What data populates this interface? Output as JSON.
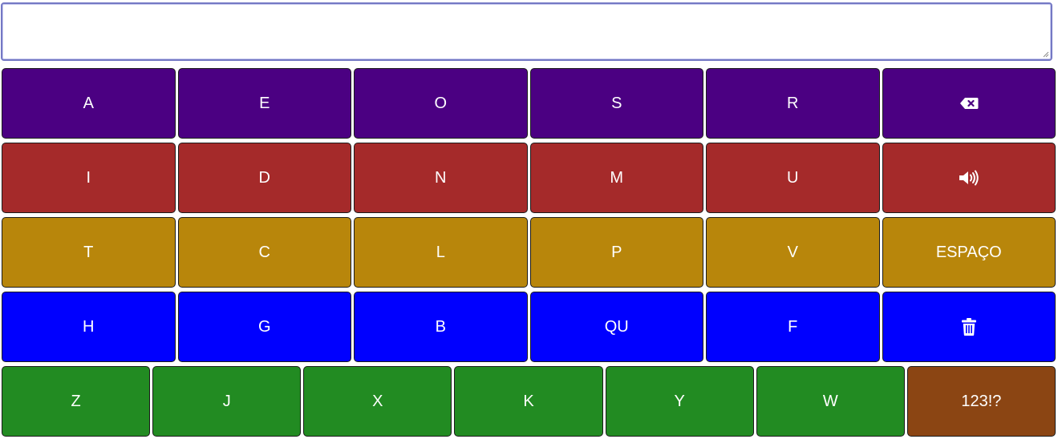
{
  "input": {
    "value": "",
    "placeholder": ""
  },
  "colors": {
    "row1": "#4b0082",
    "row2": "#a52a2a",
    "row3": "#b8860b",
    "row4": "#0000ff",
    "row5": "#228b22",
    "numbers_key": "#8b4513"
  },
  "rows": [
    {
      "keys": [
        {
          "label": "A"
        },
        {
          "label": "E"
        },
        {
          "label": "O"
        },
        {
          "label": "S"
        },
        {
          "label": "R"
        },
        {
          "label": "",
          "icon": "backspace-icon"
        }
      ]
    },
    {
      "keys": [
        {
          "label": "I"
        },
        {
          "label": "D"
        },
        {
          "label": "N"
        },
        {
          "label": "M"
        },
        {
          "label": "U"
        },
        {
          "label": "",
          "icon": "speaker-icon"
        }
      ]
    },
    {
      "keys": [
        {
          "label": "T"
        },
        {
          "label": "C"
        },
        {
          "label": "L"
        },
        {
          "label": "P"
        },
        {
          "label": "V"
        },
        {
          "label": "ESPAÇO"
        }
      ]
    },
    {
      "keys": [
        {
          "label": "H"
        },
        {
          "label": "G"
        },
        {
          "label": "B"
        },
        {
          "label": "QU"
        },
        {
          "label": "F"
        },
        {
          "label": "",
          "icon": "trash-icon"
        }
      ]
    },
    {
      "keys": [
        {
          "label": "Z"
        },
        {
          "label": "J"
        },
        {
          "label": "X"
        },
        {
          "label": "K"
        },
        {
          "label": "Y"
        },
        {
          "label": "W"
        },
        {
          "label": "123!?"
        }
      ]
    }
  ]
}
